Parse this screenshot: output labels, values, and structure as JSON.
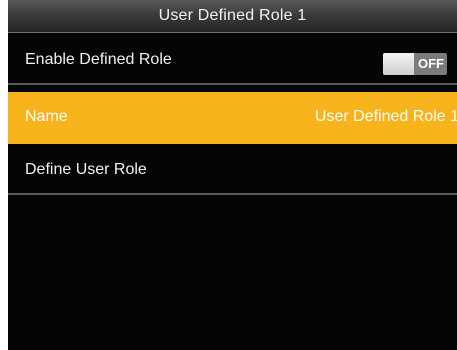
{
  "header": {
    "title": "User Defined Role 1"
  },
  "menu": {
    "items": [
      {
        "label": "Enable Defined Role",
        "toggle_state": "OFF"
      },
      {
        "label": "Name",
        "value": "User Defined Role 1"
      },
      {
        "label": "Define User Role"
      }
    ],
    "highlight_color": "#F6B31C"
  }
}
